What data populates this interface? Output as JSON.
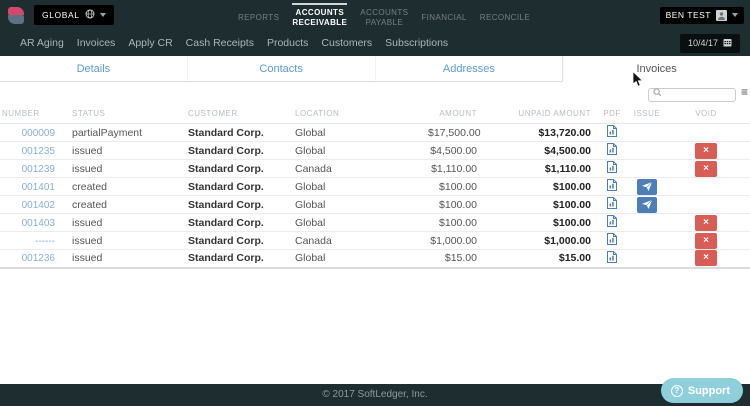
{
  "topbar": {
    "entity_selector": {
      "label": "GLOBAL"
    },
    "nav_items": [
      {
        "label": "REPORTS",
        "active": false
      },
      {
        "label": "ACCOUNTS\nRECEIVABLE",
        "active": true
      },
      {
        "label": "ACCOUNTS\nPAYABLE",
        "active": false
      },
      {
        "label": "FINANCIAL",
        "active": false
      },
      {
        "label": "RECONCILE",
        "active": false
      }
    ],
    "user_menu": {
      "label": "BEN TEST"
    }
  },
  "subnav": {
    "items": [
      "AR Aging",
      "Invoices",
      "Apply CR",
      "Cash Receipts",
      "Products",
      "Customers",
      "Subscriptions"
    ],
    "date": "10/4/17"
  },
  "content_tabs": [
    {
      "label": "Details",
      "active": false
    },
    {
      "label": "Contacts",
      "active": false
    },
    {
      "label": "Addresses",
      "active": false
    },
    {
      "label": "Invoices",
      "active": true
    }
  ],
  "search": {
    "value": "",
    "placeholder": ""
  },
  "table": {
    "columns": [
      "NUMBER",
      "STATUS",
      "CUSTOMER",
      "LOCATION",
      "AMOUNT",
      "UNPAID AMOUNT",
      "PDF",
      "ISSUE",
      "VOID"
    ],
    "rows": [
      {
        "number": "000009",
        "status": "partialPayment",
        "customer": "Standard Corp.",
        "location": "Global",
        "amount": "$17,500.00",
        "unpaid": "$13,720.00",
        "pdf": true,
        "issue": false,
        "void": false
      },
      {
        "number": "001235",
        "status": "issued",
        "customer": "Standard Corp.",
        "location": "Global",
        "amount": "$4,500.00",
        "unpaid": "$4,500.00",
        "pdf": true,
        "issue": false,
        "void": true
      },
      {
        "number": "001239",
        "status": "issued",
        "customer": "Standard Corp.",
        "location": "Canada",
        "amount": "$1,110.00",
        "unpaid": "$1,110.00",
        "pdf": true,
        "issue": false,
        "void": true
      },
      {
        "number": "001401",
        "status": "created",
        "customer": "Standard Corp.",
        "location": "Global",
        "amount": "$100.00",
        "unpaid": "$100.00",
        "pdf": true,
        "issue": true,
        "void": false
      },
      {
        "number": "001402",
        "status": "created",
        "customer": "Standard Corp.",
        "location": "Global",
        "amount": "$100.00",
        "unpaid": "$100.00",
        "pdf": true,
        "issue": true,
        "void": false
      },
      {
        "number": "001403",
        "status": "issued",
        "customer": "Standard Corp.",
        "location": "Global",
        "amount": "$100.00",
        "unpaid": "$100.00",
        "pdf": true,
        "issue": false,
        "void": true
      },
      {
        "number": "------",
        "status": "issued",
        "customer": "Standard Corp.",
        "location": "Canada",
        "amount": "$1,000.00",
        "unpaid": "$1,000.00",
        "pdf": true,
        "issue": false,
        "void": true
      },
      {
        "number": "001236",
        "status": "issued",
        "customer": "Standard Corp.",
        "location": "Global",
        "amount": "$15.00",
        "unpaid": "$15.00",
        "pdf": true,
        "issue": false,
        "void": true
      }
    ]
  },
  "footer": {
    "copyright": "© 2017 SoftLedger, Inc.",
    "support_label": "Support"
  },
  "icons": {
    "void_x": "×",
    "hamburger": "≡",
    "question": "?"
  },
  "colors": {
    "header_bg": "#1e2d2f",
    "link_blue": "#5b9bd5",
    "issue_blue": "#4d7eb8",
    "void_red": "#d95c55",
    "support_teal": "#8ecfdb",
    "logo_pink": "#d4496b",
    "logo_slate": "#5e7183"
  }
}
